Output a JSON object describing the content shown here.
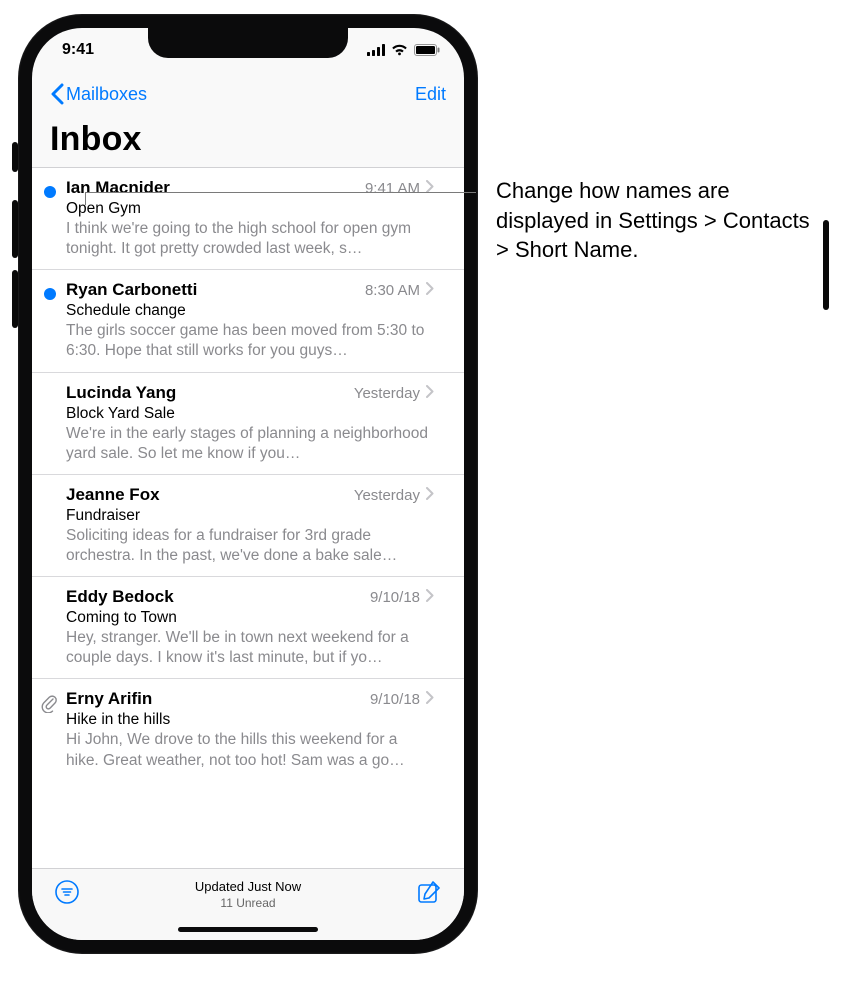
{
  "status": {
    "time": "9:41"
  },
  "nav": {
    "back": "Mailboxes",
    "edit": "Edit"
  },
  "title": "Inbox",
  "messages": [
    {
      "sender": "Ian Macnider",
      "time": "9:41 AM",
      "subject": "Open Gym",
      "preview": "I think we're going to the high school for open gym tonight. It got pretty crowded last week, s…",
      "unread": true,
      "attachment": false
    },
    {
      "sender": "Ryan Carbonetti",
      "time": "8:30 AM",
      "subject": "Schedule change",
      "preview": "The girls soccer game has been moved from 5:30 to 6:30. Hope that still works for you guys…",
      "unread": true,
      "attachment": false
    },
    {
      "sender": "Lucinda Yang",
      "time": "Yesterday",
      "subject": "Block Yard Sale",
      "preview": "We're in the early stages of planning a neighborhood yard sale. So let me know if you…",
      "unread": false,
      "attachment": false
    },
    {
      "sender": "Jeanne Fox",
      "time": "Yesterday",
      "subject": "Fundraiser",
      "preview": "Soliciting ideas for a fundraiser for 3rd grade orchestra. In the past, we've done a bake sale…",
      "unread": false,
      "attachment": false
    },
    {
      "sender": "Eddy Bedock",
      "time": "9/10/18",
      "subject": "Coming to Town",
      "preview": "Hey, stranger. We'll be in town next weekend for a couple days. I know it's last minute, but if yo…",
      "unread": false,
      "attachment": false
    },
    {
      "sender": "Erny Arifin",
      "time": "9/10/18",
      "subject": "Hike in the hills",
      "preview": "Hi John, We drove to the hills this weekend for a hike. Great weather, not too hot! Sam was a go…",
      "unread": false,
      "attachment": true
    }
  ],
  "toolbar": {
    "status_line1": "Updated Just Now",
    "status_line2": "11 Unread"
  },
  "callout": {
    "text": "Change how names are displayed in Settings > Contacts > Short Name."
  }
}
